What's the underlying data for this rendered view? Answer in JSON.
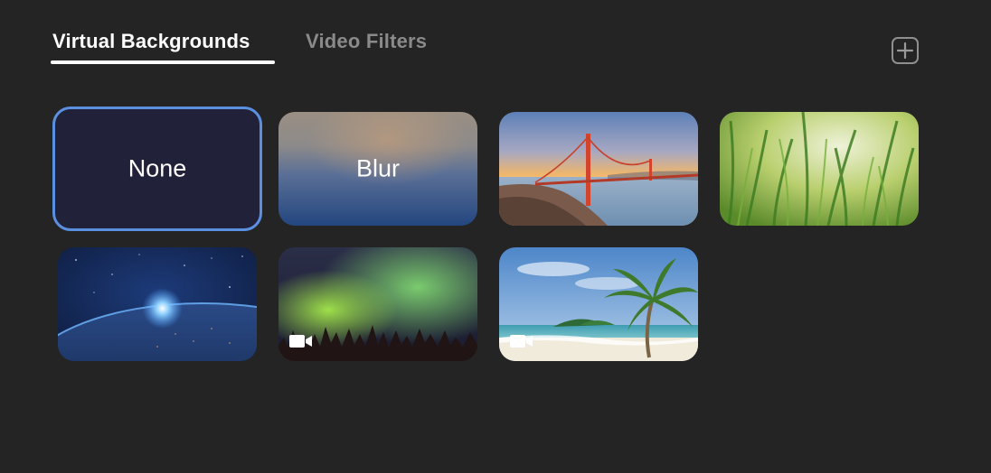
{
  "tabs": [
    {
      "label": "Virtual Backgrounds",
      "active": true
    },
    {
      "label": "Video Filters",
      "active": false
    }
  ],
  "toolbar": {
    "add_icon": "plus-square-icon"
  },
  "backgrounds": [
    {
      "label": "None",
      "selected": true
    },
    {
      "label": "Blur",
      "selected": false
    },
    {
      "scene": "golden-gate-bridge",
      "video": false
    },
    {
      "scene": "green-grass",
      "video": false
    },
    {
      "scene": "earth-from-space",
      "video": false
    },
    {
      "scene": "northern-lights",
      "video": true
    },
    {
      "scene": "tropical-beach",
      "video": true
    }
  ],
  "colors": {
    "background": "#242424",
    "accent": "#5b8fe0",
    "tab_active": "#ffffff",
    "tab_inactive": "#8a8a8a"
  }
}
